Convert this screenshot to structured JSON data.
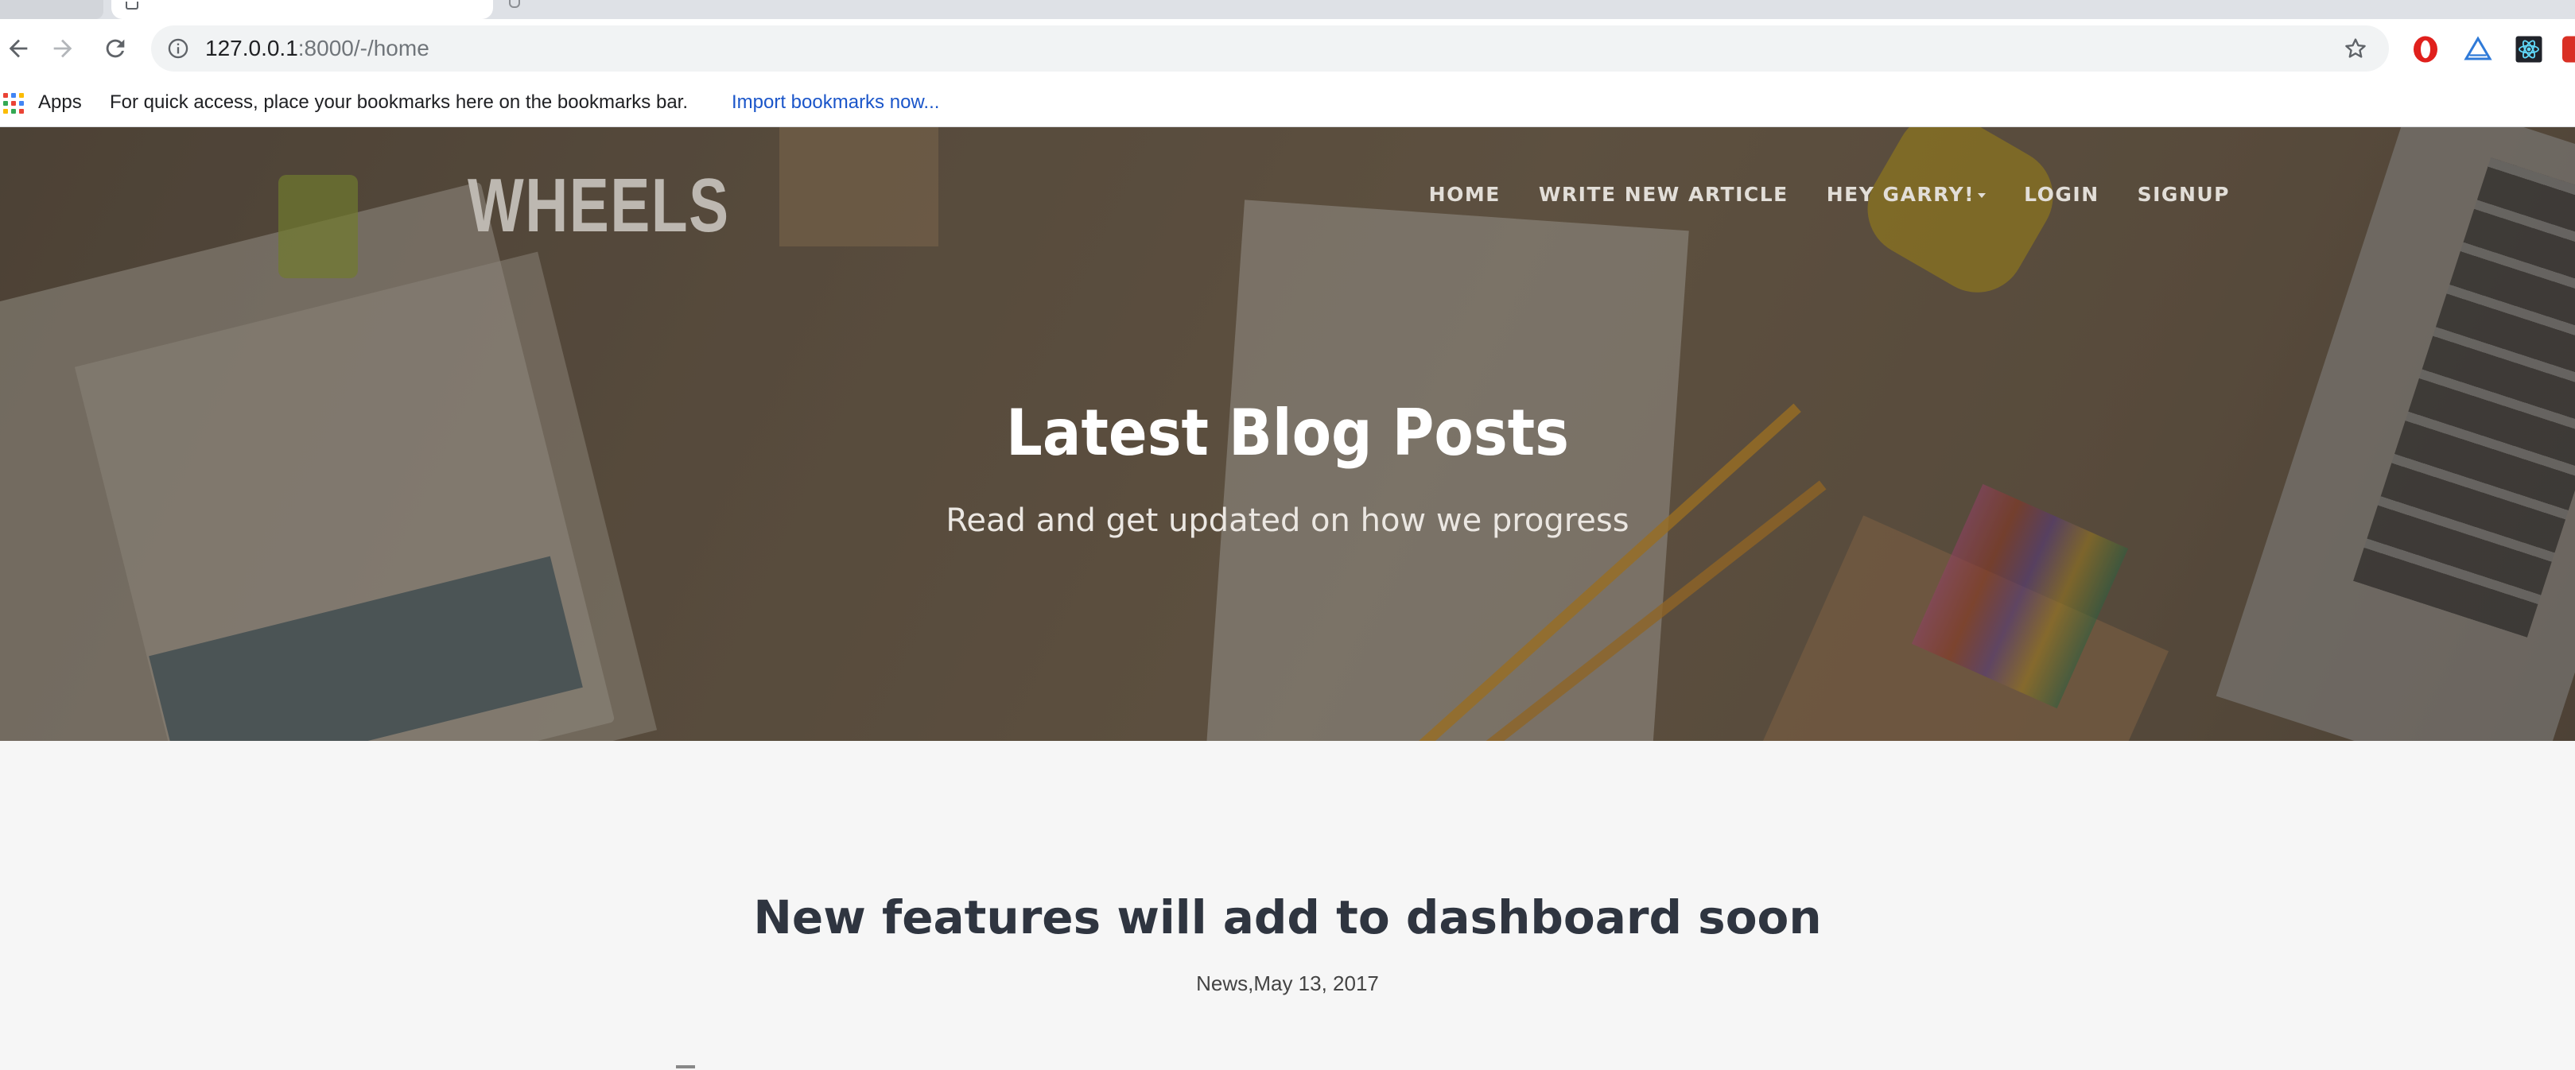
{
  "browser": {
    "address": {
      "host": "127.0.0.1",
      "path": ":8000/-/home"
    },
    "bookmarks_bar": {
      "apps_label": "Apps",
      "hint": "For quick access, place your bookmarks here on the bookmarks bar.",
      "import_link": "Import bookmarks now..."
    },
    "icons": [
      "back-icon",
      "forward-icon",
      "reload-icon",
      "info-icon",
      "star-icon",
      "opera-extension-icon",
      "triangle-extension-icon",
      "react-devtools-icon",
      "red-extension-icon"
    ]
  },
  "site": {
    "logo": "WHEELS",
    "nav": [
      {
        "label": "HOME"
      },
      {
        "label": "WRITE NEW ARTICLE"
      },
      {
        "label": "HEY GARRY!"
      },
      {
        "label": "LOGIN"
      },
      {
        "label": "SIGNUP"
      }
    ],
    "hero": {
      "title": "Latest Blog Posts",
      "subtitle": "Read and get updated on how we progress"
    }
  },
  "posts": [
    {
      "title": "New features will add to dashboard soon",
      "meta": "News,May 13, 2017"
    }
  ],
  "colors": {
    "link_blue": "#1a55c9",
    "content_bg": "#f6f6f6",
    "post_title": "#2f3540"
  }
}
